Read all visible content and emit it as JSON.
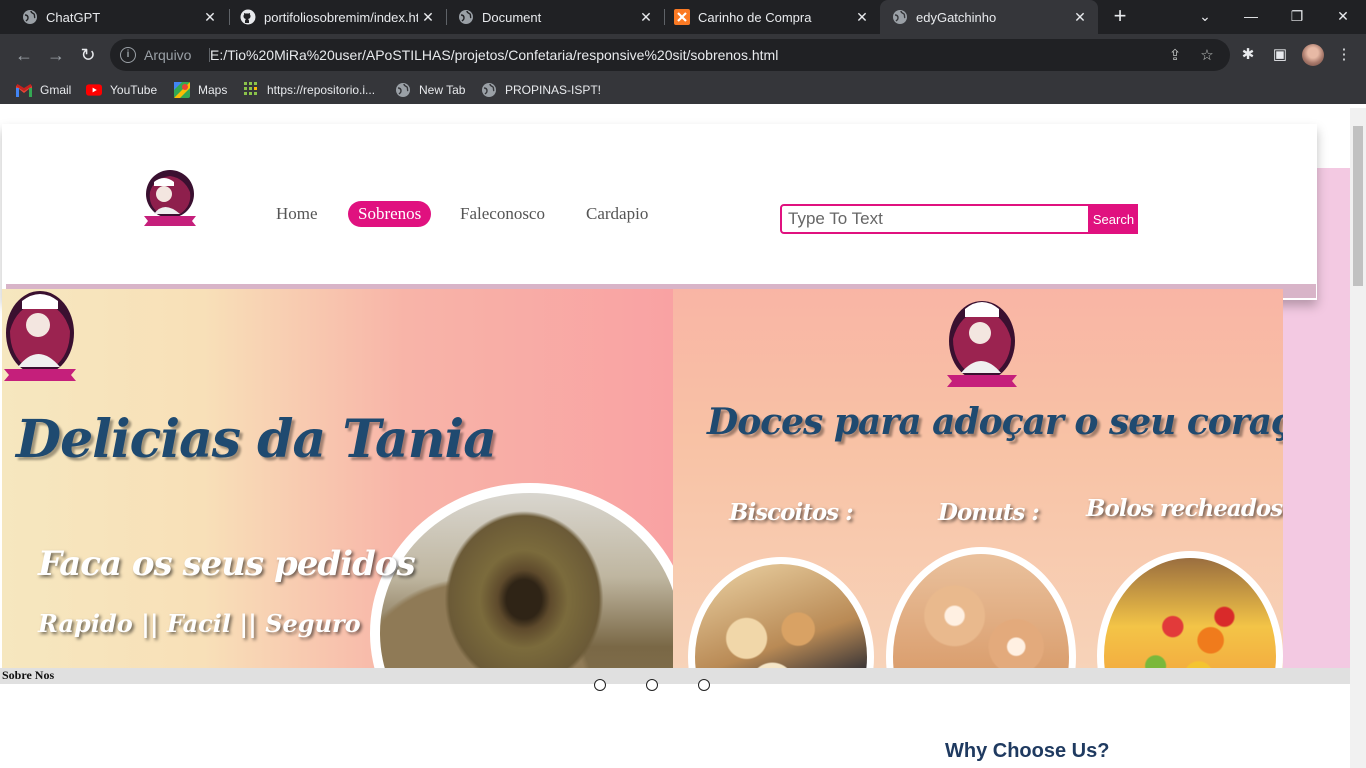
{
  "browser": {
    "tabs": [
      {
        "title": "ChatGPT",
        "icon": "globe-icon"
      },
      {
        "title": "portifoliosobremim/index.htm",
        "icon": "github-icon"
      },
      {
        "title": "Document",
        "icon": "globe-icon"
      },
      {
        "title": "Carinho de Compra",
        "icon": "xampp-icon"
      },
      {
        "title": "edyGatchinho",
        "icon": "globe-icon",
        "active": true
      }
    ],
    "address": {
      "scheme_label": "Arquivo",
      "url": "E:/Tio%20MiRa%20user/APoSTILHAS/projetos/Confetaria/responsive%20sit/sobrenos.html"
    },
    "bookmarks": [
      {
        "label": "Gmail",
        "icon": "gmail-icon"
      },
      {
        "label": "YouTube",
        "icon": "youtube-icon"
      },
      {
        "label": "Maps",
        "icon": "maps-icon"
      },
      {
        "label": "https://repositorio.i...",
        "icon": "grid-icon"
      },
      {
        "label": "New Tab",
        "icon": "globe-icon"
      },
      {
        "label": "PROPINAS-ISPT!",
        "icon": "globe-icon"
      }
    ]
  },
  "site": {
    "nav": [
      {
        "label": "Home"
      },
      {
        "label": "Sobrenos",
        "active": true
      },
      {
        "label": "Faleconosco"
      },
      {
        "label": "Cardapio"
      }
    ],
    "search": {
      "placeholder": "Type To Text",
      "value": "",
      "button": "Search"
    },
    "banner_left": {
      "title": "Delicias da Tania",
      "tagline": "Faca os seus pedidos",
      "subtagline": "Rapido || Facil || Seguro"
    },
    "banner_right": {
      "slogan": "Doces  para adoçar o seu coração",
      "categories": [
        {
          "label": "Biscoitos :"
        },
        {
          "label": "Donuts :"
        },
        {
          "label": "Bolos recheados :"
        }
      ]
    },
    "about_label": "Sobre Nos",
    "slider_dots": 3,
    "why_heading": "Why Choose Us?"
  },
  "colors": {
    "accent": "#e0117f",
    "heading_blue": "#1f4a70",
    "backdrop_pink": "#f3c9e2"
  }
}
